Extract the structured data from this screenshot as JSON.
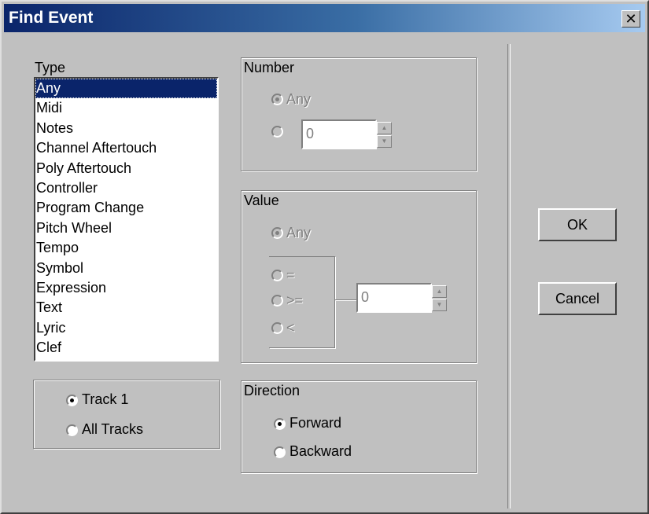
{
  "window": {
    "title": "Find Event",
    "close_glyph": "✕"
  },
  "type_group": {
    "label": "Type",
    "items": [
      "Any",
      "Midi",
      "Notes",
      "Channel Aftertouch",
      "Poly Aftertouch",
      "Controller",
      "Program Change",
      "Pitch Wheel",
      "Tempo",
      "Symbol",
      "Expression",
      "Text",
      "Lyric",
      "Clef"
    ],
    "selected_index": 0
  },
  "number_group": {
    "label": "Number",
    "any_label": "Any",
    "value": "0"
  },
  "value_group": {
    "label": "Value",
    "any_label": "Any",
    "eq_label": "=",
    "gte_label": ">=",
    "lt_label": "<",
    "value": "0"
  },
  "track_group": {
    "track1_label": "Track 1",
    "all_tracks_label": "All Tracks",
    "selected": "track1"
  },
  "direction_group": {
    "label": "Direction",
    "forward_label": "Forward",
    "backward_label": "Backward",
    "selected": "forward"
  },
  "buttons": {
    "ok_label": "OK",
    "cancel_label": "Cancel"
  },
  "colors": {
    "selection": "#0a246a",
    "face": "#c0c0c0",
    "disabled_text": "#808080"
  },
  "icons": {
    "close": "close-icon",
    "spin_up": "spin-up-arrow-icon",
    "spin_down": "spin-down-arrow-icon"
  }
}
